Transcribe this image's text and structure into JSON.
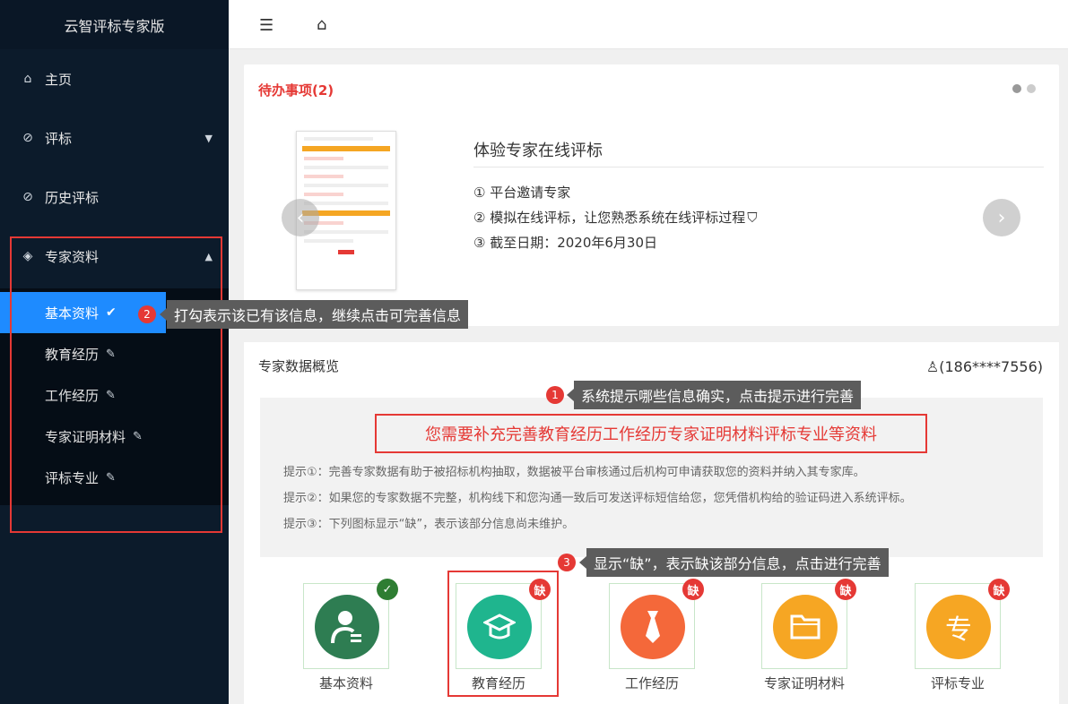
{
  "sidebar": {
    "brand": "云智评标专家版",
    "items": [
      {
        "label": "主页",
        "icon": "⌂"
      },
      {
        "label": "评标",
        "icon": "⊘"
      },
      {
        "label": "历史评标",
        "icon": "⊘"
      },
      {
        "label": "专家资料",
        "icon": "◈"
      }
    ],
    "sub_items": [
      {
        "label": "基本资料"
      },
      {
        "label": "教育经历"
      },
      {
        "label": "工作经历"
      },
      {
        "label": "专家证明材料"
      },
      {
        "label": "评标专业"
      }
    ]
  },
  "topbar": {
    "menu_icon": "☰",
    "home_icon": "⌂"
  },
  "todo": {
    "title": "待办事项(2)",
    "event_title": "体验专家在线评标",
    "steps": [
      "① 平台邀请专家",
      "② 模拟在线评标，让您熟悉系统在线评标过程",
      "③ 截至日期：2020年6月30日"
    ]
  },
  "overview": {
    "title": "专家数据概览",
    "user": "(186****7556)",
    "notice_main": "您需要补充完善教育经历工作经历专家证明材料评标专业等资料",
    "tips": [
      "提示①：完善专家数据有助于被招标机构抽取，数据被平台审核通过后机构可申请获取您的资料并纳入其专家库。",
      "提示②：如果您的专家数据不完整，机构线下和您沟通一致后可发送评标短信给您，您凭借机构给的验证码进入系统评标。",
      "提示③：下列图标显示“缺”，表示该部分信息尚未维护。"
    ],
    "cards": [
      {
        "label": "基本资料",
        "color": "#2e7d52",
        "icon": "person-icon",
        "status": "ok"
      },
      {
        "label": "教育经历",
        "color": "#1fb58e",
        "icon": "graduation-cap-icon",
        "status": "缺"
      },
      {
        "label": "工作经历",
        "color": "#f4683a",
        "icon": "tie-icon",
        "status": "缺"
      },
      {
        "label": "专家证明材料",
        "color": "#f6a623",
        "icon": "folder-icon",
        "status": "缺"
      },
      {
        "label": "评标专业",
        "color": "#f6a623",
        "icon": "zhuan-icon",
        "status": "缺"
      }
    ],
    "zhuan_glyph": "专"
  },
  "tooltips": {
    "t1": {
      "num": "1",
      "text": "系统提示哪些信息确实，点击提示进行完善"
    },
    "t2": {
      "num": "2",
      "text": "打勾表示该已有该信息，继续点击可完善信息"
    },
    "t3": {
      "num": "3",
      "text": "显示“缺”，表示缺该部分信息，点击进行完善"
    }
  }
}
